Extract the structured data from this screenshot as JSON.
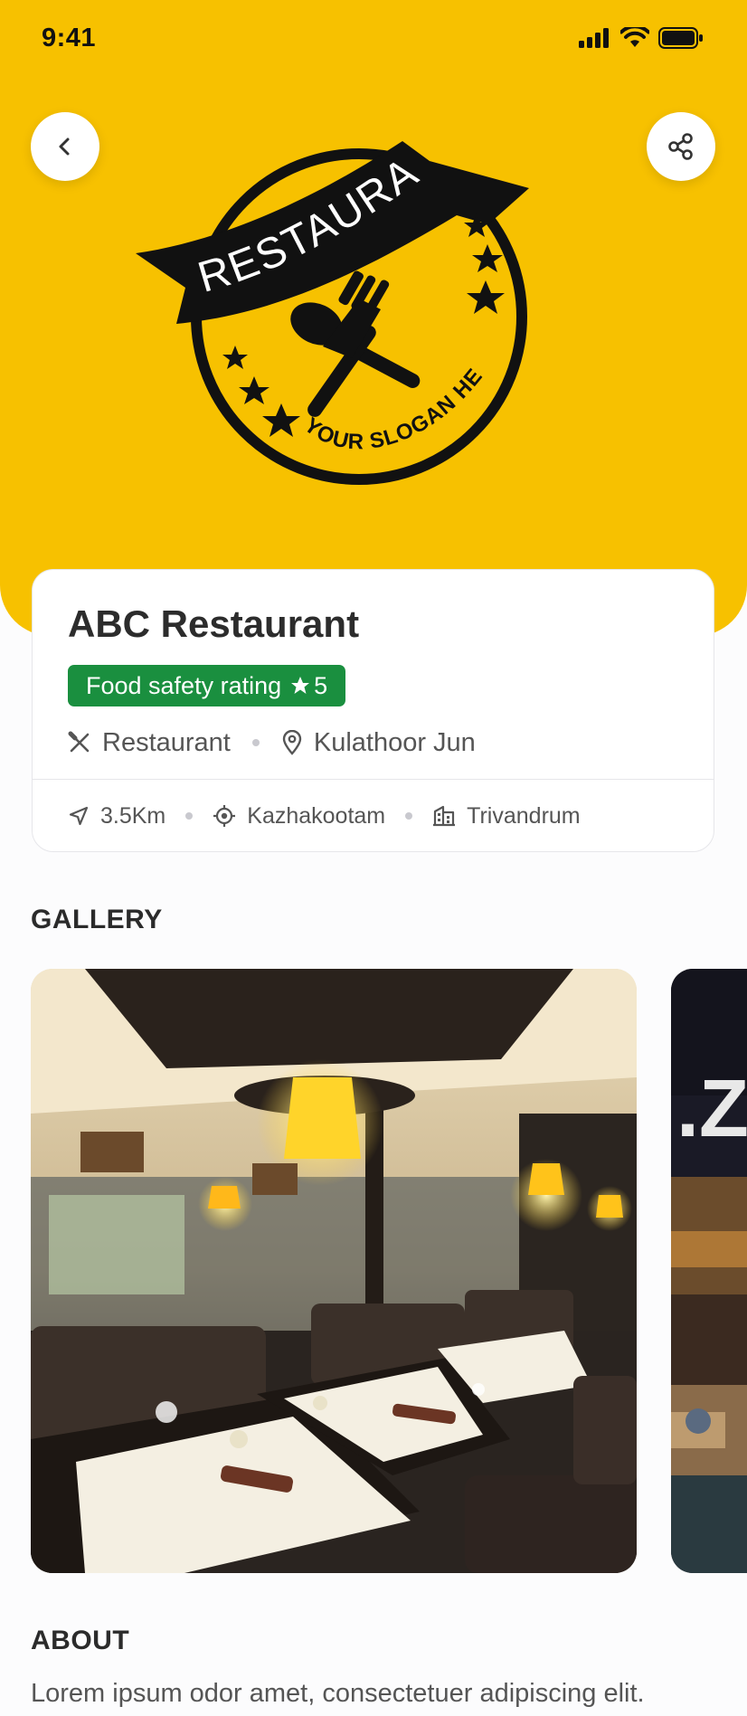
{
  "status_bar": {
    "time": "9:41",
    "icons": [
      "signal-icon",
      "wifi-icon",
      "battery-icon"
    ]
  },
  "header": {
    "back_icon": "chevron-left-icon",
    "share_icon": "share-icon",
    "logo": {
      "banner_text": "RESTAURANT",
      "slogan_text": "YOUR SLOGAN HERE"
    }
  },
  "restaurant": {
    "name": "ABC Restaurant",
    "rating_label": "Food safety rating",
    "rating_value": "5",
    "category": "Restaurant",
    "location": "Kulathoor Jun",
    "distance": "3.5Km",
    "area": "Kazhakootam",
    "city": "Trivandrum"
  },
  "gallery": {
    "title": "GALLERY"
  },
  "about": {
    "title": "ABOUT",
    "text": "Lorem ipsum odor amet, consectetuer adipiscing elit."
  },
  "colors": {
    "brand_yellow": "#f7c100",
    "rating_green": "#1a8f3f"
  }
}
